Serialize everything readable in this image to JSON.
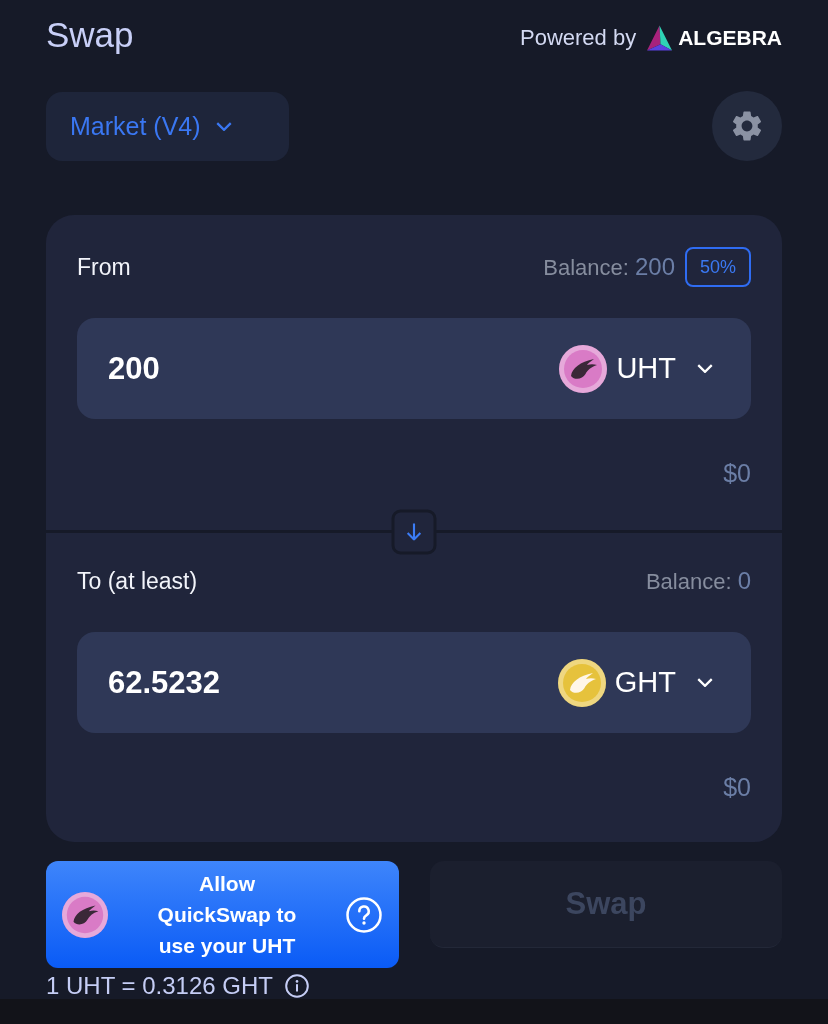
{
  "header": {
    "title": "Swap",
    "powered_by": "Powered by",
    "brand": "ALGEBRA"
  },
  "toolbar": {
    "mode": "Market (V4)"
  },
  "sections": [
    {
      "label": "From",
      "balance_label": "Balance:",
      "balance": "200",
      "percent_button": "50%",
      "amount": "200",
      "token": {
        "symbol": "UHT",
        "color": "#d97bc6"
      },
      "usd": "$0"
    },
    {
      "label": "To (at least)",
      "balance_label": "Balance:",
      "balance": "0",
      "amount": "62.5232",
      "token": {
        "symbol": "GHT",
        "color": "#e6c23c"
      },
      "usd": "$0"
    }
  ],
  "approve_button": {
    "label": "Allow\nQuickSwap to\nuse your UHT"
  },
  "swap_button": {
    "label": "Swap",
    "disabled": true
  },
  "rate": "1 UHT = 0.3126 GHT"
}
